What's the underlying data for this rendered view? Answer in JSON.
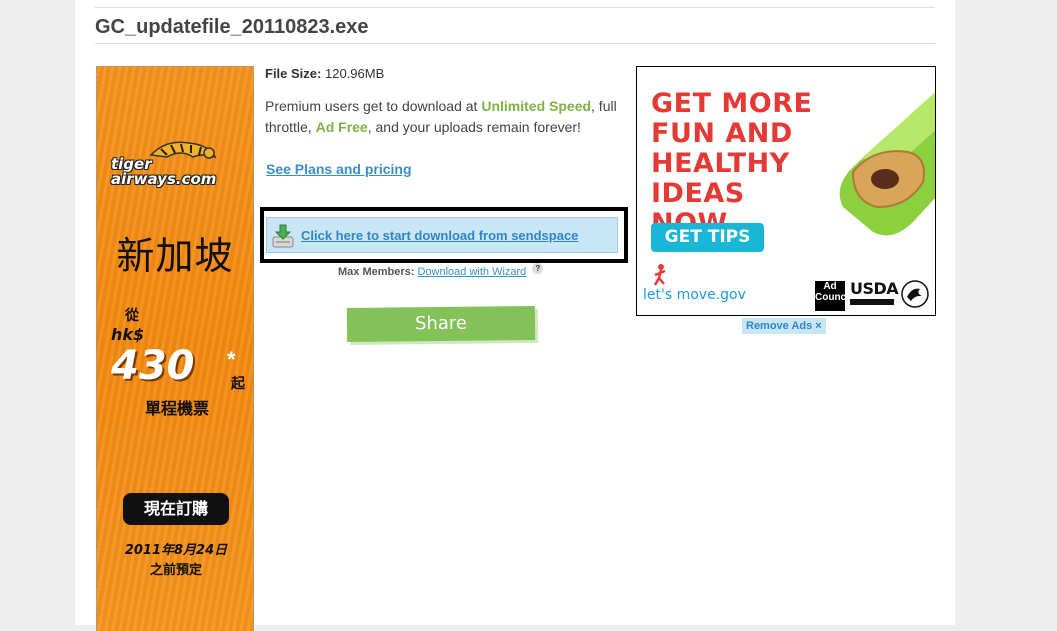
{
  "file": {
    "name": "GC_updatefile_20110823.exe",
    "size_label": "File Size:",
    "size_value": "120.96MB"
  },
  "premium": {
    "text_1": "Premium users get to download at ",
    "unlimited_speed": "Unlimited Speed",
    "text_2": ", full throttle, ",
    "ad_free": "Ad Free",
    "text_3": ", and your uploads remain forever!",
    "plans_link": "See Plans and pricing"
  },
  "download": {
    "button_label": "Click here to start download from sendspace",
    "max_members_label": "Max Members:",
    "wizard_link": "Download with Wizard",
    "help_glyph": "?"
  },
  "share": {
    "label": "Share"
  },
  "tiger_ad": {
    "logo_line1": "tiger",
    "logo_line2": "airways.com",
    "city": "新加坡",
    "from": "從",
    "currency": "hk$",
    "price": "430",
    "star": "*",
    "qi": "起",
    "oneway": "單程機票",
    "buy_now": "現在訂購",
    "deadline": "2011年8月24日",
    "deadline_suffix": "之前預定"
  },
  "right_ad": {
    "headline_1": "GET MORE",
    "headline_2": "FUN AND",
    "headline_3": "HEALTHY",
    "headline_4": "IDEAS NOW",
    "tips_button": "GET TIPS",
    "letsmove": "let's move.gov",
    "adcouncil": "Ad Council",
    "usda": "USDA",
    "remove_ads": "Remove Ads ×"
  },
  "colors": {
    "accent_green": "#7cb342",
    "link_blue": "#3a8fc8",
    "ad_red": "#e53935",
    "tiger_orange": "#f7941d"
  }
}
